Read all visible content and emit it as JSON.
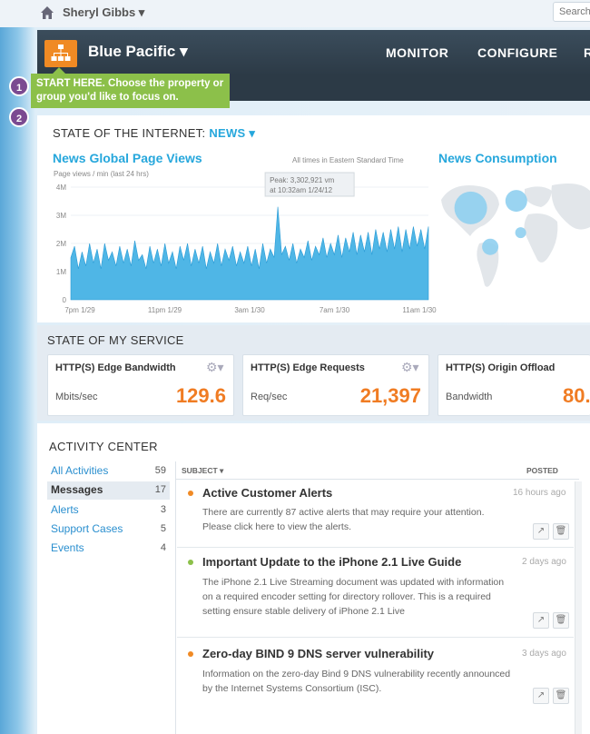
{
  "user": {
    "name": "Sheryl Gibbs ▾"
  },
  "search": {
    "placeholder": "Search"
  },
  "header": {
    "property": "Blue Pacific ▾",
    "nav": [
      "MONITOR",
      "CONFIGURE",
      "R"
    ]
  },
  "callout": {
    "text": "START HERE. Choose the property or group you'd like to focus on.",
    "steps": [
      "1",
      "2"
    ]
  },
  "internet": {
    "title_prefix": "STATE OF THE INTERNET: ",
    "title_link": "NEWS ▾",
    "page_views_title": "News Global Page Views",
    "page_views_unit": "Page views / min (last 24 hrs)",
    "timezone_note": "All times in Eastern Standard Time",
    "consumption_title": "News Consumption",
    "peak_label": "Peak: 3,302,921 vm",
    "peak_time": "at 10:32am 1/24/12"
  },
  "chart_data": {
    "type": "area",
    "title": "News Global Page Views",
    "ylabel": "Page views / min (last 24 hrs)",
    "y_ticks": [
      "4M",
      "3M",
      "2M",
      "1M",
      "0"
    ],
    "x_ticks": [
      "7pm 1/29",
      "11pm 1/29",
      "3am 1/30",
      "7am 1/30",
      "11am 1/30"
    ],
    "ylim": [
      0,
      4000000
    ],
    "color": "#4fb6e6",
    "peak": {
      "value": 3302921,
      "label": "10:32am 1/24/12"
    },
    "values": [
      1.5,
      1.9,
      1.1,
      1.7,
      1.2,
      2.0,
      1.3,
      1.8,
      1.1,
      2.0,
      1.4,
      1.7,
      1.2,
      1.9,
      1.3,
      1.8,
      1.2,
      2.1,
      1.4,
      1.6,
      1.1,
      1.9,
      1.3,
      1.8,
      1.2,
      2.0,
      1.3,
      1.7,
      1.1,
      1.9,
      1.4,
      2.0,
      1.2,
      1.8,
      1.3,
      1.9,
      1.1,
      1.7,
      1.3,
      2.0,
      1.2,
      1.8,
      1.4,
      1.9,
      1.2,
      1.7,
      1.3,
      1.9,
      1.2,
      1.8,
      1.1,
      2.0,
      1.3,
      1.8,
      1.5,
      3.3,
      1.6,
      1.9,
      1.4,
      2.0,
      1.3,
      1.8,
      1.5,
      2.1,
      1.4,
      1.9,
      1.6,
      2.2,
      1.5,
      2.0,
      1.6,
      2.3,
      1.5,
      2.2,
      1.7,
      2.4,
      1.6,
      2.3,
      1.7,
      2.4,
      1.6,
      2.5,
      1.8,
      2.4,
      1.7,
      2.5,
      1.8,
      2.6,
      1.7,
      2.5,
      1.8,
      2.6,
      1.9,
      2.5,
      1.8,
      2.6
    ]
  },
  "map": {
    "bubbles": [
      {
        "lon": -95,
        "lat": 40,
        "size": 3
      },
      {
        "lon": 10,
        "lat": 50,
        "size": 2
      },
      {
        "lon": -50,
        "lat": -15,
        "size": 1.5
      },
      {
        "lon": 20,
        "lat": 5,
        "size": 1
      }
    ],
    "bubble_color": "#8fcff0"
  },
  "service": {
    "title": "STATE OF MY SERVICE",
    "cards": [
      {
        "title": "HTTP(S) Edge Bandwidth",
        "unit": "Mbits/sec",
        "value": "129.6"
      },
      {
        "title": "HTTP(S) Edge Requests",
        "unit": "Req/sec",
        "value": "21,397"
      },
      {
        "title": "HTTP(S) Origin Offload",
        "unit": "Bandwidth",
        "value": "80."
      }
    ]
  },
  "activity": {
    "title": "ACTIVITY CENTER",
    "items": [
      {
        "label": "All Activities",
        "count": "59"
      },
      {
        "label": "Messages",
        "count": "17"
      },
      {
        "label": "Alerts",
        "count": "3"
      },
      {
        "label": "Support Cases",
        "count": "5"
      },
      {
        "label": "Events",
        "count": "4"
      }
    ],
    "col_subject": "SUBJECT ▾",
    "col_posted": "POSTED",
    "messages": [
      {
        "title": "Active Customer Alerts",
        "time": "16 hours ago",
        "body": "There are currently 87 active alerts that may require your attention. Please click here to view the alerts.",
        "dot": "#f08a24"
      },
      {
        "title": "Important Update to the iPhone 2.1 Live Guide",
        "time": "2 days ago",
        "body": "The iPhone 2.1 Live Streaming document was updated with information on a required encoder setting for directory rollover. This is a required setting ensure stable delivery of iPhone 2.1 Live",
        "dot": "#8cc04a"
      },
      {
        "title": "Zero-day BIND 9 DNS server vulnerability",
        "time": "3 days ago",
        "body": "Information on the zero-day Bind 9 DNS vulnerability recently announced by the Internet Systems Consortium (ISC).",
        "dot": "#f08a24"
      }
    ]
  },
  "icons": {
    "share": "↗",
    "trash": "🗑"
  }
}
